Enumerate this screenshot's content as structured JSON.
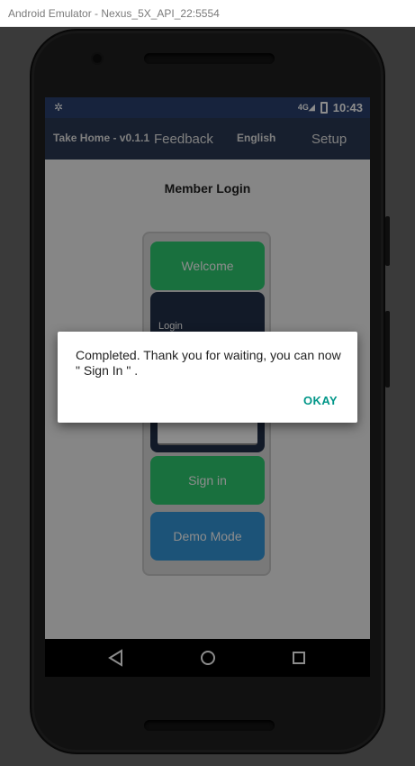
{
  "window": {
    "title": "Android Emulator - Nexus_5X_API_22:5554"
  },
  "status_bar": {
    "network": "4G",
    "time": "10:43"
  },
  "app_bar": {
    "title": "Take Home - v0.1.1",
    "feedback": "Feedback",
    "language": "English",
    "setup": "Setup"
  },
  "page": {
    "heading": "Member Login",
    "welcome_button": "Welcome",
    "login_label": "Login",
    "signin_button": "Sign in",
    "demo_button": "Demo Mode"
  },
  "dialog": {
    "message": "Completed. Thank you for waiting, you can now \" Sign In \" .",
    "ok_button": "OKAY"
  },
  "colors": {
    "status_bar": "#2a4170",
    "app_bar": "#2b3a55",
    "green_button": "#2ecc71",
    "blue_button": "#3498db",
    "dialog_action": "#009688"
  },
  "icons": [
    "settings-icon",
    "signal-icon",
    "battery-icon",
    "back-icon",
    "home-icon",
    "recents-icon"
  ]
}
